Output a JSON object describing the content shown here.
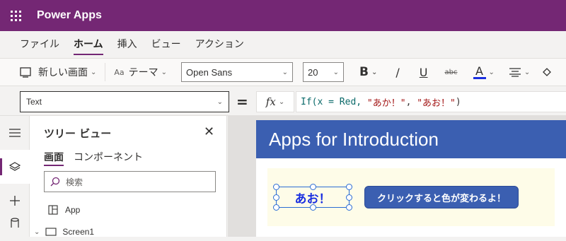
{
  "app": {
    "title": "Power Apps"
  },
  "menu": {
    "tabs": [
      "ファイル",
      "ホーム",
      "挿入",
      "ビュー",
      "アクション"
    ],
    "active": "ホーム"
  },
  "toolbar": {
    "new_screen": "新しい画面",
    "theme": "テーマ",
    "font_family": "Open Sans",
    "font_size": "20",
    "bold": "B",
    "italic": "/",
    "underline": "U",
    "strike": "abc",
    "font_color_letter": "A"
  },
  "formula_bar": {
    "property": "Text",
    "equals": "=",
    "fx": "fx",
    "formula_parts": {
      "fn": "If(x = Red, ",
      "s1": "\"あか！\"",
      "sep": ", ",
      "s2": "\"あお！\"",
      "close": ")"
    }
  },
  "tree_view": {
    "title": "ツリー ビュー",
    "tabs": {
      "screens": "画面",
      "components": "コンポーネント"
    },
    "search_placeholder": "検索",
    "items": {
      "app": "App",
      "screen1": "Screen1"
    }
  },
  "canvas": {
    "header": "Apps for Introduction",
    "label_text": "あお！",
    "button_text": "クリックすると色が変わるよ！"
  },
  "colors": {
    "brand": "#742774",
    "header": "#3b5fb1",
    "label_text": "#1a2fe0"
  }
}
